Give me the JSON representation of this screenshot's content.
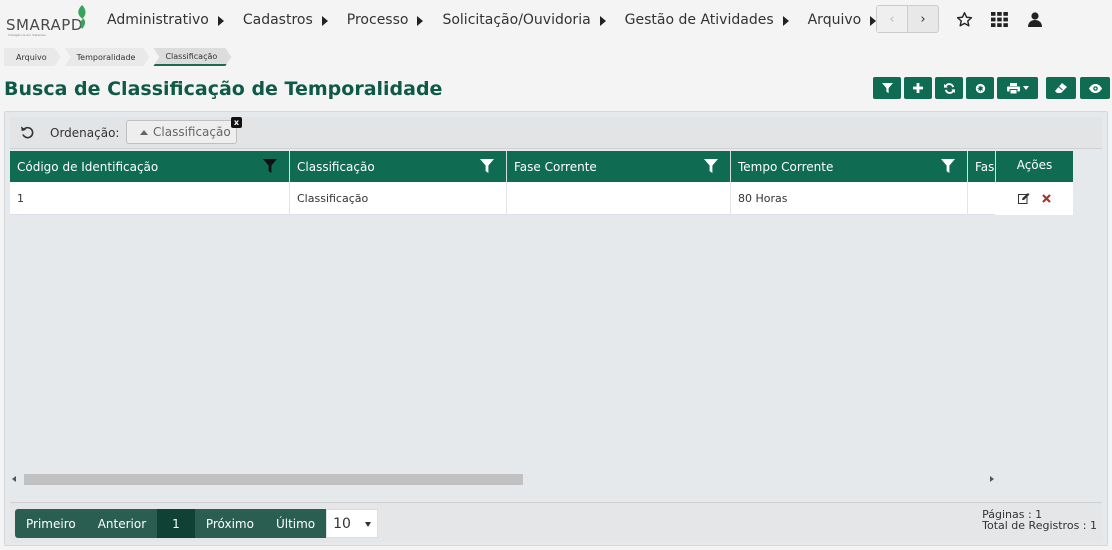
{
  "app": {
    "logo_text": "SMARAPD",
    "logo_tagline": "Inteligência em Sistemas"
  },
  "menu": [
    {
      "label": "Administrativo"
    },
    {
      "label": "Cadastros"
    },
    {
      "label": "Processo"
    },
    {
      "label": "Solicitação/Ouvidoria"
    },
    {
      "label": "Gestão de Atividades"
    },
    {
      "label": "Arquivo"
    }
  ],
  "nav_buttons": {
    "prev": "‹",
    "next": "›"
  },
  "top_icons": [
    "star-icon",
    "grid-apps-icon",
    "user-icon"
  ],
  "breadcrumb": [
    "Arquivo",
    "Temporalidade",
    "Classificação"
  ],
  "page_title": "Busca de Classificação de Temporalidade",
  "toolbar": [
    "filter-icon",
    "plus-icon",
    "refresh-icon",
    "gear-icon",
    "print-icon",
    "eraser-icon",
    "eye-icon"
  ],
  "sort": {
    "label": "Ordenação:",
    "chip": "Classificação",
    "chip_remove": "x"
  },
  "grid": {
    "columns": [
      "Código de Identificação",
      "Classificação",
      "Fase Corrente",
      "Tempo Corrente",
      "Fase"
    ],
    "actions_header": "Ações",
    "rows": [
      {
        "codigo": "1",
        "classificacao": "Classificação",
        "fase_corrente": "",
        "tempo_corrente": "80 Horas",
        "fase": ""
      }
    ]
  },
  "pager": {
    "first": "Primeiro",
    "previous": "Anterior",
    "current": "1",
    "next": "Próximo",
    "last": "Último",
    "page_size": "10"
  },
  "stats": {
    "pages": "Páginas : 1",
    "total": "Total de Registros : 1"
  },
  "colors": {
    "primary": "#0f6b52",
    "title": "#0f5a46",
    "pager": "#2a5e50",
    "delete": "#b0302a"
  }
}
